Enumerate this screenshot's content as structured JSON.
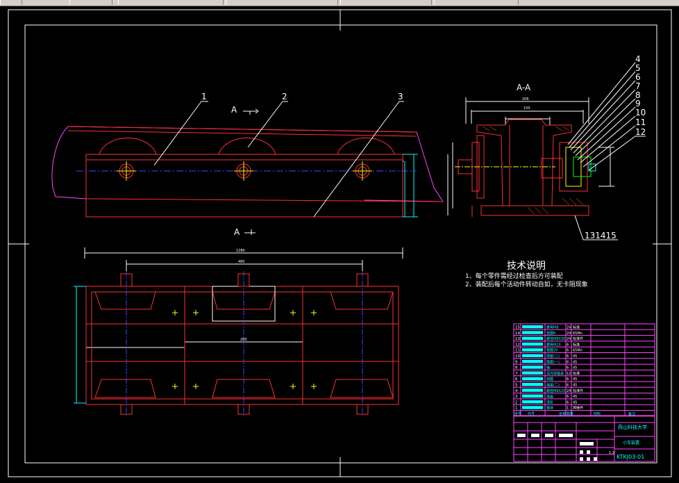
{
  "section_label": "A-A",
  "section_marks": {
    "top": "A",
    "bottom": "A"
  },
  "balloons_main": [
    "1",
    "2",
    "3"
  ],
  "balloons_section": [
    "4",
    "5",
    "6",
    "7",
    "8",
    "9",
    "10",
    "11",
    "12"
  ],
  "balloon_bottom": "131415",
  "tech_notes": {
    "title": "技术说明",
    "line1": "1、每个零件需经过检查后方可装配",
    "line2": "2、装配后每个活动件转动自如，无卡阻现象"
  },
  "bom_rows": [
    {
      "no": "15",
      "name": "螺母M8",
      "qty": "24",
      "mat": "标准"
    },
    {
      "no": "14",
      "name": "垫圈8",
      "qty": "24",
      "mat": "65Mn"
    },
    {
      "no": "13",
      "name": "螺栓M8X30",
      "qty": "24",
      "mat": "标准件"
    },
    {
      "no": "12",
      "name": "螺母M20",
      "qty": "6",
      "mat": "标准"
    },
    {
      "no": "11",
      "name": "垫圈20",
      "qty": "6",
      "mat": "65Mn"
    },
    {
      "no": "10",
      "name": "隔套(二)",
      "qty": "6",
      "mat": "45"
    },
    {
      "no": "9",
      "name": "隔套(一)",
      "qty": "6",
      "mat": "45"
    },
    {
      "no": "8",
      "name": "轴",
      "qty": "6",
      "mat": "45"
    },
    {
      "no": "7",
      "name": "深沟球轴承",
      "qty": "12",
      "mat": "标准"
    },
    {
      "no": "6",
      "name": "挡圈",
      "qty": "6",
      "mat": "45"
    },
    {
      "no": "5",
      "name": "端盖(二)",
      "qty": "6",
      "mat": "45"
    },
    {
      "no": "4",
      "name": "螺栓M8X20",
      "qty": "24",
      "mat": "标准件"
    },
    {
      "no": "3",
      "name": "端盖",
      "qty": "6",
      "mat": "45"
    },
    {
      "no": "2",
      "name": "滚轮",
      "qty": "6",
      "mat": "45"
    },
    {
      "no": "1",
      "name": "箱体",
      "qty": "1",
      "mat": "焊接件"
    }
  ],
  "bom_header": [
    "序号",
    "代号",
    "名称",
    "数量",
    "材料",
    "备注"
  ],
  "title_block": {
    "school": "燕山科技大学",
    "drawing_name": "小车装置",
    "drawing_no": "KTKJ03-01",
    "scale": "1:2"
  },
  "dims_plan": {
    "overall": "1280",
    "inner": "480",
    "mid": "280"
  },
  "dims_section": {
    "width": "206",
    "inner": "150"
  }
}
